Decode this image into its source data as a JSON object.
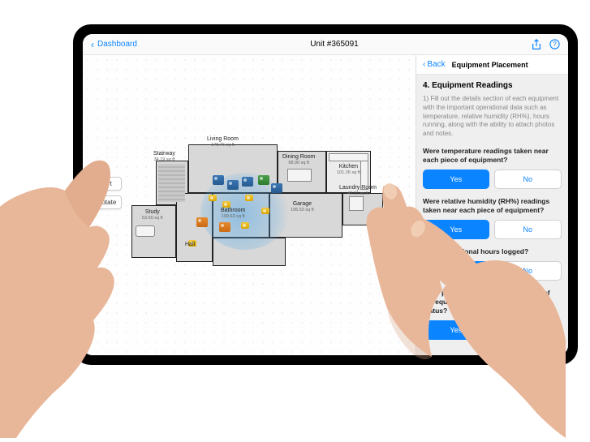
{
  "nav": {
    "back_label": "Dashboard",
    "title": "Unit #365091"
  },
  "canvas": {
    "tools": {
      "insert": "Insert",
      "rotate": "Rotate"
    },
    "rooms": {
      "living": {
        "name": "Living Room",
        "sqft": "178.76 sq ft"
      },
      "dining": {
        "name": "Dining Room",
        "sqft": "98.90 sq ft"
      },
      "kitchen": {
        "name": "Kitchen",
        "sqft": "101.26 sq ft"
      },
      "stairway": {
        "name": "Stairway",
        "sqft": "34.19 sq ft"
      },
      "study": {
        "name": "Study",
        "sqft": "53.60 sq ft"
      },
      "hall": {
        "name": "Hall",
        "sqft": ""
      },
      "bathroom": {
        "name": "Bathroom",
        "sqft": "109.63 sq ft"
      },
      "garage": {
        "name": "Garage",
        "sqft": "195.53 sq ft"
      },
      "laundry": {
        "name": "Laundry Room",
        "sqft": "40.91 sq ft"
      }
    }
  },
  "panel": {
    "back_label": "Back",
    "header_title": "Equipment Placement",
    "section_title": "4. Equipment Readings",
    "section_desc": "1) Fill out the details section of each equipment with the important operational data such as temperature, relative humidity (RH%), hours running, along with the ability to attach photos and notes.",
    "yes": "Yes",
    "no": "No",
    "questions": [
      {
        "text": "Were temperature readings taken near each piece of equipment?"
      },
      {
        "text": "Were relative humidity (RH%) readings taken near each piece of equipment?"
      },
      {
        "text": "Were operational hours logged?"
      },
      {
        "text": "Were photos taken upon installation of the equipment to attach and confirm its status?"
      }
    ]
  }
}
